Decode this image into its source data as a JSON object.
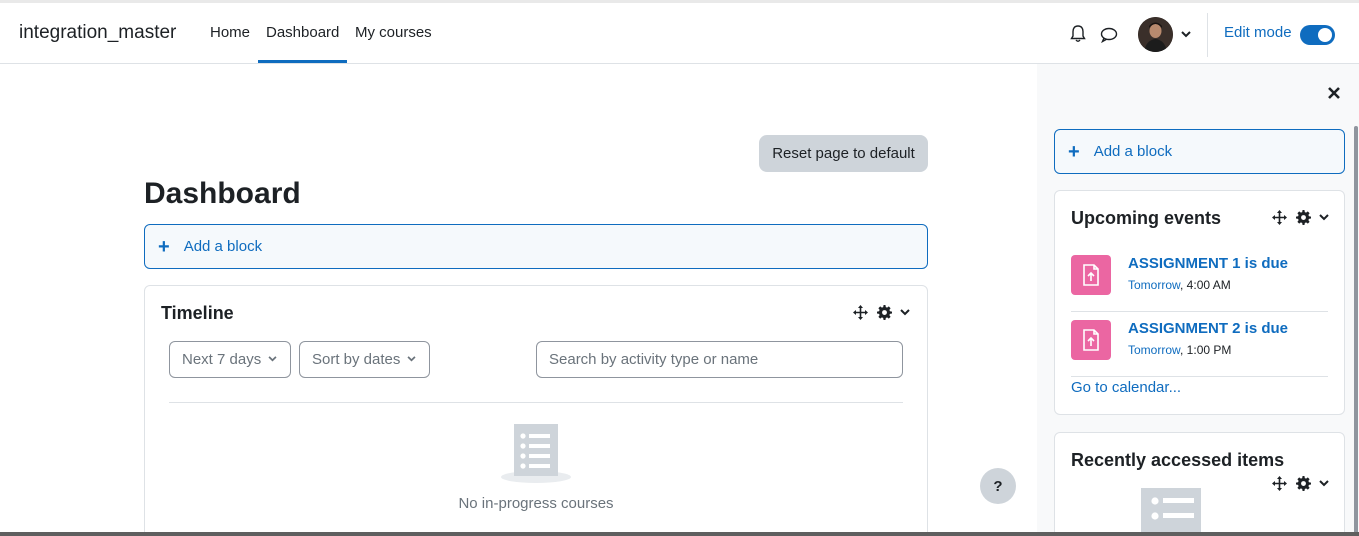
{
  "header": {
    "site_name": "integration_master",
    "nav": [
      {
        "label": "Home"
      },
      {
        "label": "Dashboard",
        "active": true
      },
      {
        "label": "My courses"
      }
    ],
    "edit_mode_label": "Edit mode",
    "edit_mode_on": true
  },
  "main": {
    "reset_label": "Reset page to default",
    "title": "Dashboard",
    "add_block_label": "Add a block",
    "timeline": {
      "title": "Timeline",
      "filter_label": "Next 7 days",
      "sort_label": "Sort by dates",
      "search_placeholder": "Search by activity type or name",
      "empty_message": "No in-progress courses"
    },
    "help_label": "?"
  },
  "drawer": {
    "add_block_label": "Add a block",
    "upcoming": {
      "title": "Upcoming events",
      "events": [
        {
          "title": "ASSIGNMENT 1 is due",
          "day": "Tomorrow",
          "time": ", 4:00 AM"
        },
        {
          "title": "ASSIGNMENT 2 is due",
          "day": "Tomorrow",
          "time": ", 1:00 PM"
        }
      ],
      "calendar_link": "Go to calendar..."
    },
    "recent": {
      "title": "Recently accessed items"
    }
  },
  "colors": {
    "primary": "#0f6cbf",
    "assignment_icon_bg": "#eb66a2",
    "reset_button_bg": "#ced4da"
  }
}
